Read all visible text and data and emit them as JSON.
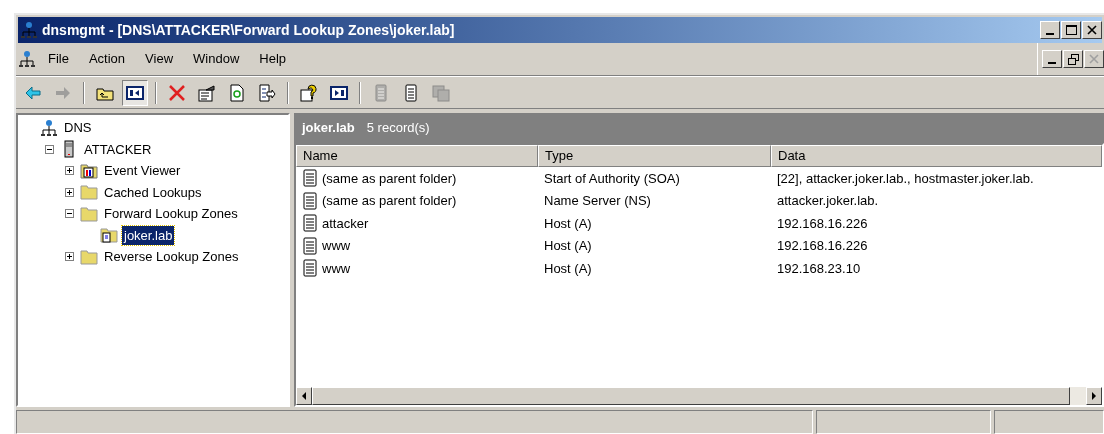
{
  "window": {
    "title": "dnsmgmt - [DNS\\ATTACKER\\Forward Lookup Zones\\joker.lab]"
  },
  "menu": [
    "File",
    "Action",
    "View",
    "Window",
    "Help"
  ],
  "toolbar": [
    {
      "kind": "back",
      "disabled": false,
      "pressed": false
    },
    {
      "kind": "forward",
      "disabled": true,
      "pressed": false
    },
    {
      "kind": "sep"
    },
    {
      "kind": "up",
      "disabled": false,
      "pressed": false
    },
    {
      "kind": "tree",
      "disabled": false,
      "pressed": true
    },
    {
      "kind": "sep"
    },
    {
      "kind": "delete",
      "disabled": false,
      "pressed": false
    },
    {
      "kind": "properties",
      "disabled": false,
      "pressed": false
    },
    {
      "kind": "refresh",
      "disabled": false,
      "pressed": false
    },
    {
      "kind": "export",
      "disabled": false,
      "pressed": false
    },
    {
      "kind": "sep"
    },
    {
      "kind": "help",
      "disabled": false,
      "pressed": false
    },
    {
      "kind": "panel",
      "disabled": false,
      "pressed": false
    },
    {
      "kind": "sep"
    },
    {
      "kind": "record",
      "disabled": true,
      "pressed": false
    },
    {
      "kind": "record",
      "disabled": false,
      "pressed": false
    },
    {
      "kind": "copy",
      "disabled": true,
      "pressed": false
    }
  ],
  "tree": [
    {
      "label": "DNS",
      "kind": "dns",
      "selected": false,
      "children": [
        {
          "label": "ATTACKER",
          "kind": "server",
          "selected": false,
          "expanded": true,
          "children": [
            {
              "label": "Event Viewer",
              "kind": "events",
              "selected": false,
              "expanded": false
            },
            {
              "label": "Cached Lookups",
              "kind": "folder",
              "selected": false,
              "expanded": false
            },
            {
              "label": "Forward Lookup Zones",
              "kind": "folder",
              "selected": false,
              "expanded": true,
              "children": [
                {
                  "label": "joker.lab",
                  "kind": "zone",
                  "selected": true
                }
              ]
            },
            {
              "label": "Reverse Lookup Zones",
              "kind": "folder",
              "selected": false,
              "expanded": false
            }
          ]
        }
      ]
    }
  ],
  "results": {
    "title": "joker.lab",
    "count": "5 record(s)",
    "columns": [
      "Name",
      "Type",
      "Data"
    ],
    "rows": [
      [
        "(same as parent folder)",
        "Start of Authority (SOA)",
        "[22], attacker.joker.lab., hostmaster.joker.lab."
      ],
      [
        "(same as parent folder)",
        "Name Server (NS)",
        "attacker.joker.lab."
      ],
      [
        "attacker",
        "Host (A)",
        "192.168.16.226"
      ],
      [
        "www",
        "Host (A)",
        "192.168.16.226"
      ],
      [
        "www",
        "Host (A)",
        "192.168.23.10"
      ]
    ]
  }
}
